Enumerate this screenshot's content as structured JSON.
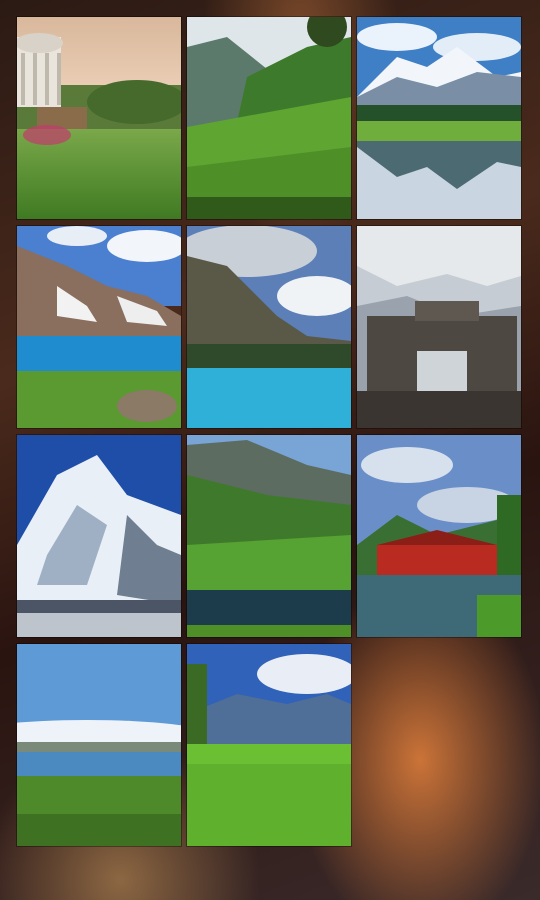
{
  "gallery": {
    "photos": [
      {
        "subject": "garden-pavilion"
      },
      {
        "subject": "green-valley"
      },
      {
        "subject": "snow-peak-lake-reflection"
      },
      {
        "subject": "mountain-lake"
      },
      {
        "subject": "turquoise-lake-clouds"
      },
      {
        "subject": "stone-gate-snow"
      },
      {
        "subject": "snow-peak"
      },
      {
        "subject": "green-hills-lake"
      },
      {
        "subject": "red-pagoda-lake"
      },
      {
        "subject": "blue-lake-meadow"
      },
      {
        "subject": "green-meadow-mountains"
      }
    ]
  }
}
